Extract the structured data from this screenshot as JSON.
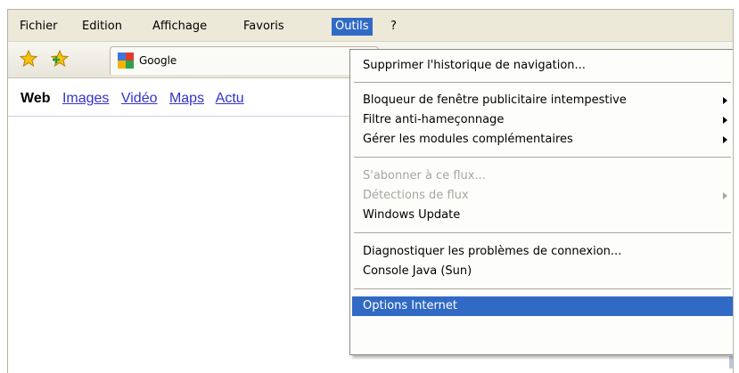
{
  "menubar": {
    "items": [
      "Fichier",
      "Edition",
      "Affichage",
      "Favoris",
      "Outils",
      "?"
    ],
    "active_item": "Outils"
  },
  "toolbar": {
    "tab_title": "Google",
    "icons": [
      "favorites-star-icon",
      "add-favorite-star-icon",
      "google-favicon-icon"
    ]
  },
  "google_nav": {
    "items": [
      "Web",
      "Images",
      "Vidéo",
      "Maps",
      "Actu"
    ]
  },
  "tools_menu": {
    "items": [
      {
        "label": "Supprimer l'historique de navigation...",
        "enabled": true,
        "submenu": false
      },
      {
        "label": "Bloqueur de fenêtre publicitaire intempestive",
        "enabled": true,
        "submenu": true
      },
      {
        "label": "Filtre anti-hameçonnage",
        "enabled": true,
        "submenu": true
      },
      {
        "label": "Gérer les modules complémentaires",
        "enabled": true,
        "submenu": true
      },
      {
        "label": "S'abonner à ce flux...",
        "enabled": false,
        "submenu": false
      },
      {
        "label": "Détections de flux",
        "enabled": false,
        "submenu": true
      },
      {
        "label": "Windows Update",
        "enabled": true,
        "submenu": false
      },
      {
        "label": "Diagnostiquer les problèmes de connexion...",
        "enabled": true,
        "submenu": false
      },
      {
        "label": "Console Java (Sun)",
        "enabled": true,
        "submenu": false
      },
      {
        "label": "Options Internet",
        "enabled": true,
        "submenu": false,
        "highlighted": true
      }
    ]
  },
  "colors": {
    "menubar_bg": "#ece9d8",
    "selection_blue": "#316ac5",
    "link_blue": "#3333cc",
    "disabled_text": "#a7a6a0"
  }
}
